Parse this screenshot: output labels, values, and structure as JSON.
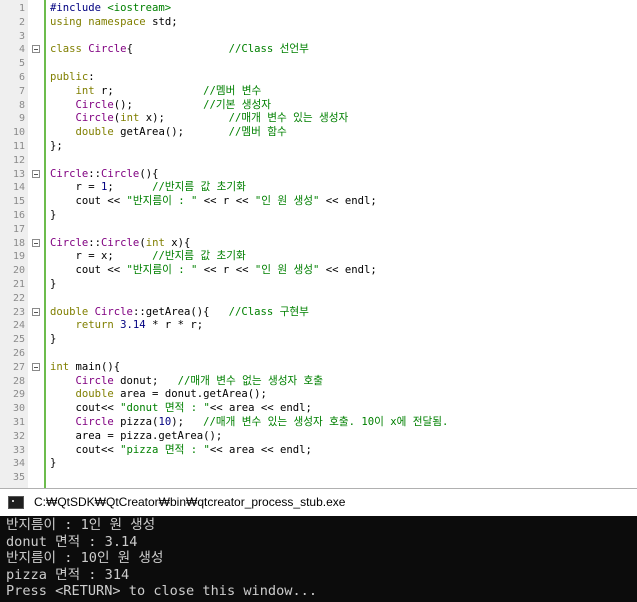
{
  "editor": {
    "lines": [
      {
        "n": "1",
        "fold": false,
        "segs": [
          [
            "pp",
            "#include "
          ],
          [
            "str",
            "<iostream>"
          ]
        ]
      },
      {
        "n": "2",
        "fold": false,
        "segs": [
          [
            "kw",
            "using namespace "
          ],
          [
            "tx",
            "std;"
          ]
        ]
      },
      {
        "n": "3",
        "fold": false,
        "segs": []
      },
      {
        "n": "4",
        "fold": true,
        "segs": [
          [
            "kw",
            "class "
          ],
          [
            "cls",
            "Circle"
          ],
          [
            "tx",
            "{               "
          ],
          [
            "cm",
            "//Class 선언부"
          ]
        ]
      },
      {
        "n": "5",
        "fold": false,
        "segs": []
      },
      {
        "n": "6",
        "fold": false,
        "segs": [
          [
            "kw",
            "public"
          ],
          [
            "tx",
            ":"
          ]
        ]
      },
      {
        "n": "7",
        "fold": false,
        "segs": [
          [
            "tx",
            "    "
          ],
          [
            "kw",
            "int "
          ],
          [
            "tx",
            "r;              "
          ],
          [
            "cm",
            "//멤버 변수"
          ]
        ]
      },
      {
        "n": "8",
        "fold": false,
        "segs": [
          [
            "tx",
            "    "
          ],
          [
            "cls",
            "Circle"
          ],
          [
            "tx",
            "();           "
          ],
          [
            "cm",
            "//기본 생성자"
          ]
        ]
      },
      {
        "n": "9",
        "fold": false,
        "segs": [
          [
            "tx",
            "    "
          ],
          [
            "cls",
            "Circle"
          ],
          [
            "tx",
            "("
          ],
          [
            "kw",
            "int "
          ],
          [
            "tx",
            "x);          "
          ],
          [
            "cm",
            "//매개 변수 있는 생성자"
          ]
        ]
      },
      {
        "n": "10",
        "fold": false,
        "segs": [
          [
            "tx",
            "    "
          ],
          [
            "kw",
            "double "
          ],
          [
            "tx",
            "getArea();       "
          ],
          [
            "cm",
            "//멤버 함수"
          ]
        ]
      },
      {
        "n": "11",
        "fold": false,
        "segs": [
          [
            "tx",
            "};"
          ]
        ]
      },
      {
        "n": "12",
        "fold": false,
        "segs": []
      },
      {
        "n": "13",
        "fold": true,
        "segs": [
          [
            "cls",
            "Circle"
          ],
          [
            "tx",
            "::"
          ],
          [
            "cls",
            "Circle"
          ],
          [
            "tx",
            "(){"
          ]
        ]
      },
      {
        "n": "14",
        "fold": false,
        "segs": [
          [
            "tx",
            "    r = "
          ],
          [
            "nm",
            "1"
          ],
          [
            "tx",
            ";      "
          ],
          [
            "cm",
            "//반지름 값 초기화"
          ]
        ]
      },
      {
        "n": "15",
        "fold": false,
        "segs": [
          [
            "tx",
            "    cout << "
          ],
          [
            "str",
            "\"반지름이 : \""
          ],
          [
            "tx",
            " << r << "
          ],
          [
            "str",
            "\"인 원 생성\""
          ],
          [
            "tx",
            " << endl;"
          ]
        ]
      },
      {
        "n": "16",
        "fold": false,
        "segs": [
          [
            "tx",
            "}"
          ]
        ]
      },
      {
        "n": "17",
        "fold": false,
        "segs": []
      },
      {
        "n": "18",
        "fold": true,
        "segs": [
          [
            "cls",
            "Circle"
          ],
          [
            "tx",
            "::"
          ],
          [
            "cls",
            "Circle"
          ],
          [
            "tx",
            "("
          ],
          [
            "kw",
            "int "
          ],
          [
            "tx",
            "x){"
          ]
        ]
      },
      {
        "n": "19",
        "fold": false,
        "segs": [
          [
            "tx",
            "    r = x;      "
          ],
          [
            "cm",
            "//반지름 값 초기화"
          ]
        ]
      },
      {
        "n": "20",
        "fold": false,
        "segs": [
          [
            "tx",
            "    cout << "
          ],
          [
            "str",
            "\"반지름이 : \""
          ],
          [
            "tx",
            " << r << "
          ],
          [
            "str",
            "\"인 원 생성\""
          ],
          [
            "tx",
            " << endl;"
          ]
        ]
      },
      {
        "n": "21",
        "fold": false,
        "segs": [
          [
            "tx",
            "}"
          ]
        ]
      },
      {
        "n": "22",
        "fold": false,
        "segs": []
      },
      {
        "n": "23",
        "fold": true,
        "segs": [
          [
            "kw",
            "double "
          ],
          [
            "cls",
            "Circle"
          ],
          [
            "tx",
            "::getArea(){   "
          ],
          [
            "cm",
            "//Class 구현부"
          ]
        ]
      },
      {
        "n": "24",
        "fold": false,
        "segs": [
          [
            "tx",
            "    "
          ],
          [
            "kw",
            "return "
          ],
          [
            "nm",
            "3.14"
          ],
          [
            "tx",
            " * r * r;"
          ]
        ]
      },
      {
        "n": "25",
        "fold": false,
        "segs": [
          [
            "tx",
            "}"
          ]
        ]
      },
      {
        "n": "26",
        "fold": false,
        "segs": []
      },
      {
        "n": "27",
        "fold": true,
        "segs": [
          [
            "kw",
            "int "
          ],
          [
            "tx",
            "main(){"
          ]
        ]
      },
      {
        "n": "28",
        "fold": false,
        "segs": [
          [
            "tx",
            "    "
          ],
          [
            "cls",
            "Circle "
          ],
          [
            "tx",
            "donut;   "
          ],
          [
            "cm",
            "//매개 변수 없는 생성자 호출"
          ]
        ]
      },
      {
        "n": "29",
        "fold": false,
        "segs": [
          [
            "tx",
            "    "
          ],
          [
            "kw",
            "double "
          ],
          [
            "tx",
            "area = donut.getArea();"
          ]
        ]
      },
      {
        "n": "30",
        "fold": false,
        "segs": [
          [
            "tx",
            "    cout<< "
          ],
          [
            "str",
            "\"donut 면적 : \""
          ],
          [
            "tx",
            "<< area << endl;"
          ]
        ]
      },
      {
        "n": "31",
        "fold": false,
        "segs": [
          [
            "tx",
            "    "
          ],
          [
            "cls",
            "Circle "
          ],
          [
            "tx",
            "pizza("
          ],
          [
            "nm",
            "10"
          ],
          [
            "tx",
            ");   "
          ],
          [
            "cm",
            "//매개 변수 있는 생성자 호출. 10이 x에 전달됨."
          ]
        ]
      },
      {
        "n": "32",
        "fold": false,
        "segs": [
          [
            "tx",
            "    area = pizza.getArea();"
          ]
        ]
      },
      {
        "n": "33",
        "fold": false,
        "segs": [
          [
            "tx",
            "    cout<< "
          ],
          [
            "str",
            "\"pizza 면적 : \""
          ],
          [
            "tx",
            "<< area << endl;"
          ]
        ]
      },
      {
        "n": "34",
        "fold": false,
        "segs": [
          [
            "tx",
            "}"
          ]
        ]
      },
      {
        "n": "35",
        "fold": false,
        "segs": []
      }
    ]
  },
  "terminal": {
    "title": "C:₩QtSDK₩QtCreator₩bin₩qtcreator_process_stub.exe",
    "output": [
      "반지름이 : 1인 원 생성",
      "donut 면적 : 3.14",
      "반지름이 : 10인 원 생성",
      "pizza 면적 : 314",
      "Press <RETURN> to close this window..."
    ]
  }
}
